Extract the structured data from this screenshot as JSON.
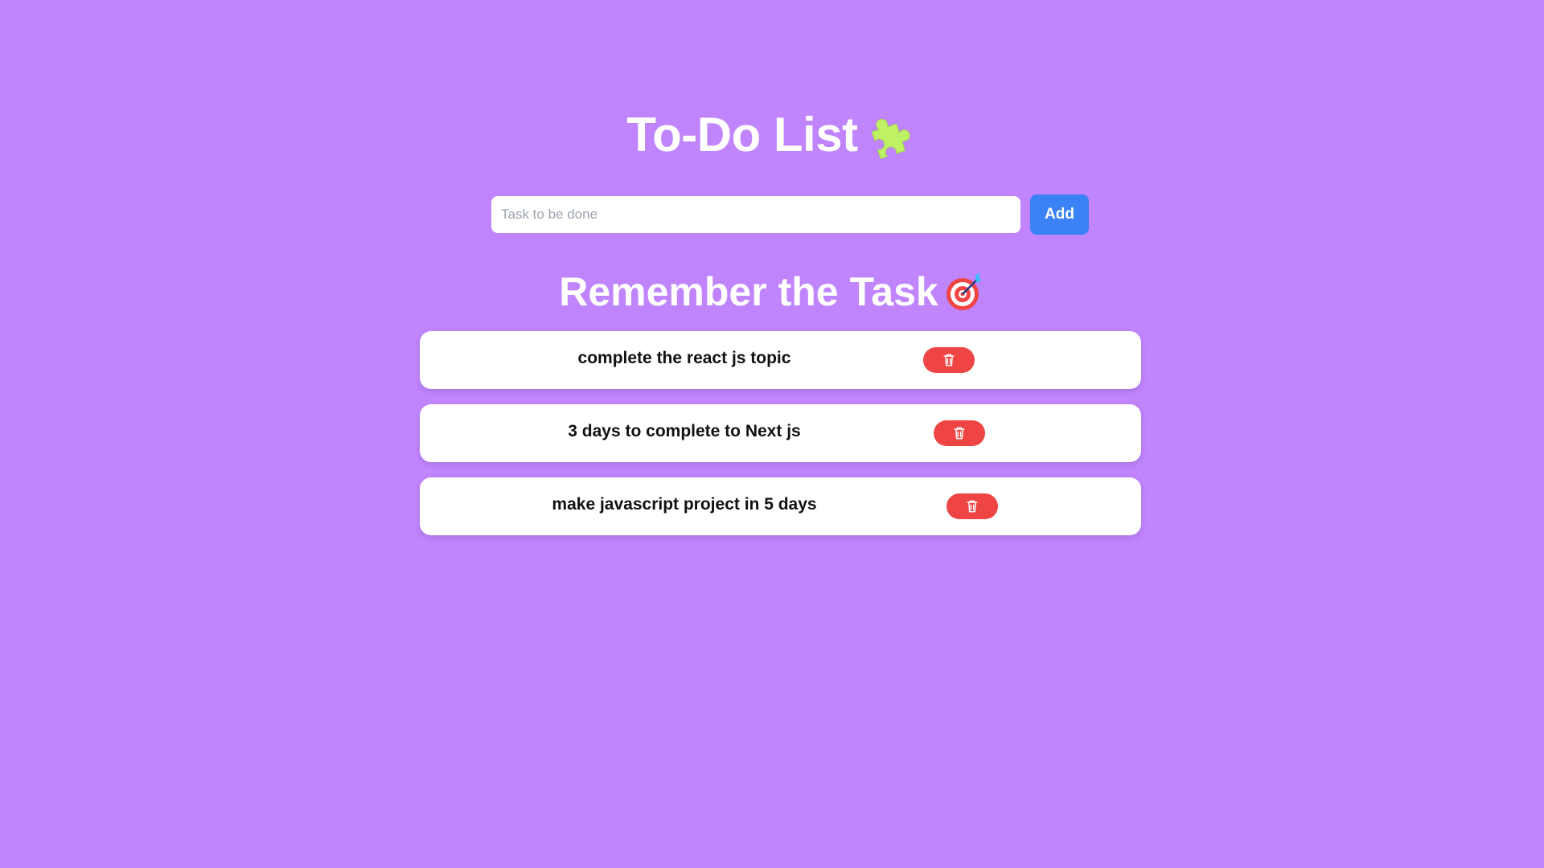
{
  "header": {
    "title": "To-Do List",
    "title_icon": "puzzle-piece-icon"
  },
  "form": {
    "placeholder": "Task to be done",
    "value": "",
    "add_label": "Add"
  },
  "list": {
    "heading": "Remember the Task",
    "heading_icon": "target-dart-icon",
    "tasks": [
      {
        "text": "complete the react js topic",
        "delete_icon": "trash-icon"
      },
      {
        "text": "3 days to complete to Next js",
        "delete_icon": "trash-icon"
      },
      {
        "text": "make javascript project in 5 days",
        "delete_icon": "trash-icon"
      }
    ]
  },
  "colors": {
    "background": "#c084fc",
    "add_button": "#3b82f6",
    "delete_button": "#ef4444",
    "card": "#ffffff",
    "puzzle_icon": "#bef264"
  }
}
